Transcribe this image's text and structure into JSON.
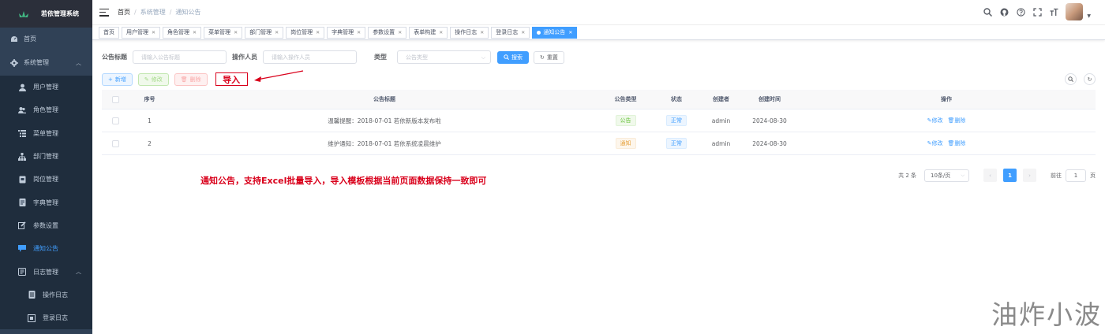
{
  "app": {
    "title": "若依管理系统"
  },
  "sidebar": {
    "items": [
      {
        "label": "首页",
        "icon": "dashboard-icon",
        "level": 0
      },
      {
        "label": "系统管理",
        "icon": "gear-icon",
        "level": 0,
        "expanded": true
      },
      {
        "label": "用户管理",
        "icon": "user-icon",
        "level": 1
      },
      {
        "label": "角色管理",
        "icon": "peoples-icon",
        "level": 1
      },
      {
        "label": "菜单管理",
        "icon": "tree-table-icon",
        "level": 1
      },
      {
        "label": "部门管理",
        "icon": "tree-icon",
        "level": 1
      },
      {
        "label": "岗位管理",
        "icon": "post-icon",
        "level": 1
      },
      {
        "label": "字典管理",
        "icon": "dict-icon",
        "level": 1
      },
      {
        "label": "参数设置",
        "icon": "edit-icon",
        "level": 1
      },
      {
        "label": "通知公告",
        "icon": "message-icon",
        "level": 1,
        "active": true
      },
      {
        "label": "日志管理",
        "icon": "log-icon",
        "level": 1,
        "expanded": true
      },
      {
        "label": "操作日志",
        "icon": "form-icon",
        "level": 2
      },
      {
        "label": "登录日志",
        "icon": "logininfor-icon",
        "level": 2
      }
    ]
  },
  "breadcrumb": [
    "首页",
    "系统管理",
    "通知公告"
  ],
  "tags": [
    "首页",
    "用户管理",
    "角色管理",
    "菜单管理",
    "部门管理",
    "岗位管理",
    "字典管理",
    "参数设置",
    "表单构建",
    "操作日志",
    "登录日志",
    "通知公告"
  ],
  "search": {
    "title_label": "公告标题",
    "title_placeholder": "请输入公告标题",
    "operator_label": "操作人员",
    "operator_placeholder": "请输入操作人员",
    "type_label": "类型",
    "type_placeholder": "公告类型",
    "search_btn": "搜索",
    "reset_btn": "重置"
  },
  "toolbar": {
    "add": "新增",
    "edit": "修改",
    "delete": "删除",
    "import": "导入"
  },
  "table": {
    "headers": [
      "序号",
      "公告标题",
      "公告类型",
      "状态",
      "创建者",
      "创建时间",
      "操作"
    ],
    "rows": [
      {
        "no": "1",
        "title": "温馨提醒：2018-07-01 若依新版本发布啦",
        "type": "公告",
        "status": "正常",
        "creator": "admin",
        "time": "2024-08-30",
        "edit": "修改",
        "delete": "删除"
      },
      {
        "no": "2",
        "title": "维护通知：2018-07-01 若依系统凌晨维护",
        "type": "通知",
        "status": "正常",
        "creator": "admin",
        "time": "2024-08-30",
        "edit": "修改",
        "delete": "删除"
      }
    ]
  },
  "annotation": "通知公告，支持Excel批量导入，导入模板根据当前页面数据保持一致即可",
  "pagination": {
    "total": "共 2 条",
    "page_size": "10条/页",
    "current": "1",
    "goto_prefix": "前往",
    "goto_value": "1",
    "goto_suffix": "页"
  },
  "watermark": "油炸小波",
  "colors": {
    "sidebar_bg": "#304156",
    "primary": "#409eff",
    "annotation_red": "#d9001b"
  }
}
